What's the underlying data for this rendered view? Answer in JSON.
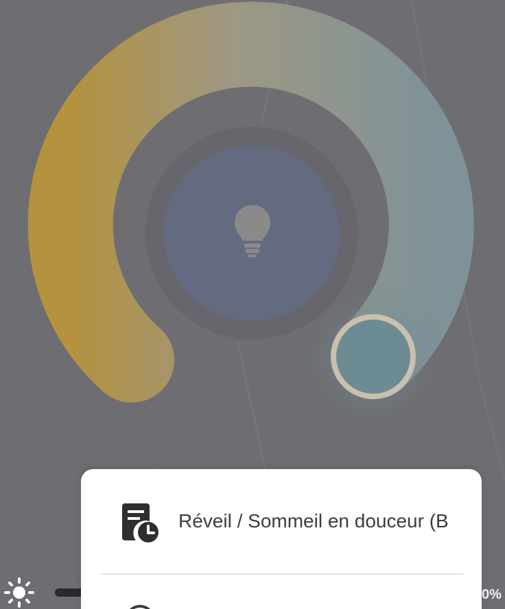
{
  "dial": {
    "warm_color": "#b4923e",
    "cool_color": "#7f9298",
    "center_color": "#646a80",
    "bulb_icon": "lightbulb-icon"
  },
  "brightness": {
    "icon": "sun-icon",
    "value_text": "0%"
  },
  "menu": {
    "items": [
      {
        "icon": "schedule-icon",
        "label": "Réveil / Sommeil en douceur (B"
      },
      {
        "icon": "clock-icon",
        "label": ""
      }
    ]
  }
}
